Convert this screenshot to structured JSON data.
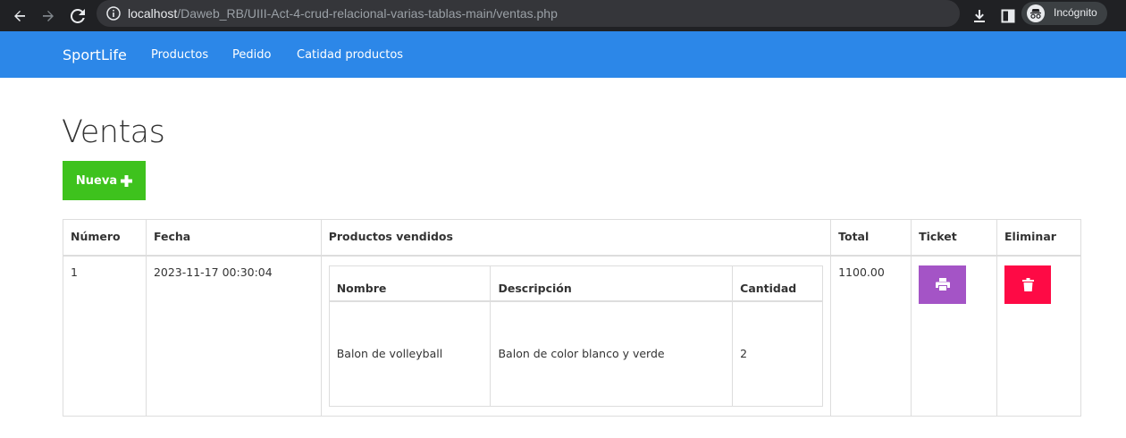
{
  "browser": {
    "url_host": "localhost",
    "url_path": "/Daweb_RB/UIII-Act-4-crud-relacional-varias-tablas-main/ventas.php",
    "incognito_label": "Incógnito"
  },
  "navbar": {
    "brand": "SportLife",
    "links": [
      "Productos",
      "Pedido",
      "Catidad productos"
    ],
    "color": "#2c87e8"
  },
  "page": {
    "title": "Ventas",
    "new_button_label": "Nueva",
    "new_button_color": "#3ec21d"
  },
  "table": {
    "headers": [
      "Número",
      "Fecha",
      "Productos vendidos",
      "Total",
      "Ticket",
      "Eliminar"
    ],
    "rows": [
      {
        "numero": "1",
        "fecha": "2023-11-17 00:30:04",
        "total": "1100.00",
        "productos": {
          "headers": [
            "Nombre",
            "Descripción",
            "Cantidad"
          ],
          "rows": [
            {
              "nombre": "Balon de volleyball",
              "descripcion": "Balon de color blanco y verde",
              "cantidad": "2"
            }
          ]
        }
      }
    ]
  },
  "icons": {
    "ticket": "print-icon",
    "delete": "trash-icon",
    "ticket_color": "#a454c6",
    "delete_color": "#fe0a45"
  }
}
